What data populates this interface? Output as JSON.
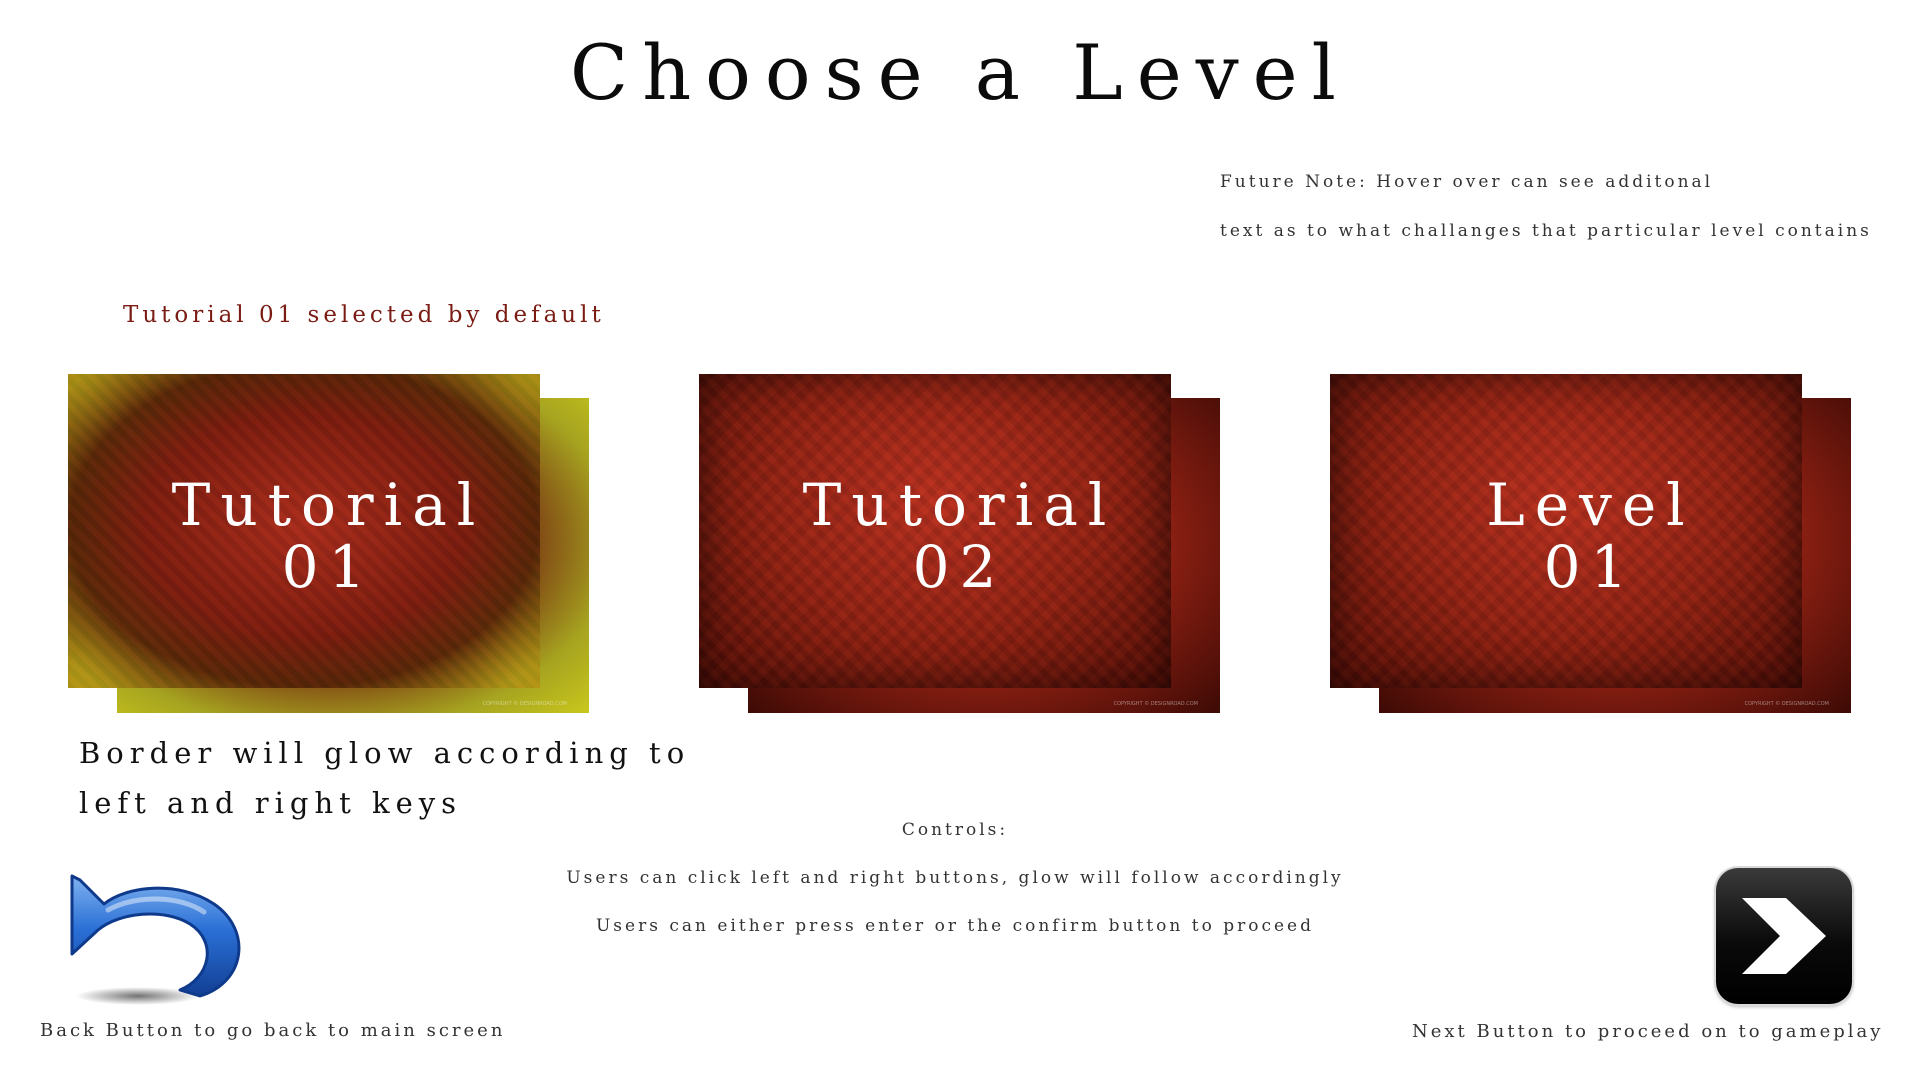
{
  "title": "Choose a Level",
  "future_note": {
    "line1": "Future Note: Hover over can see additonal",
    "line2": "text as to what challanges that particular level contains"
  },
  "default_note": "Tutorial 01 selected by default",
  "levels": [
    {
      "line1": "Tutorial",
      "line2": "01",
      "selected": true,
      "copyright": "COPYRIGHT © DESIGNROAD.COM"
    },
    {
      "line1": "Tutorial",
      "line2": "02",
      "selected": false,
      "copyright": "COPYRIGHT © DESIGNROAD.COM"
    },
    {
      "line1": "Level",
      "line2": "01",
      "selected": false,
      "copyright": "COPYRIGHT © DESIGNROAD.COM"
    }
  ],
  "glow_note": {
    "line1": "Border will glow according to",
    "line2": "left and right keys"
  },
  "controls": {
    "heading": "Controls:",
    "line1": "Users can click left and right buttons, glow will follow accordingly",
    "line2": "Users can either press enter or the confirm button to proceed"
  },
  "back_button": {
    "icon": "undo-arrow-icon",
    "caption": "Back Button to go back to main screen",
    "color": "#2a6fd6"
  },
  "next_button": {
    "icon": "chevron-right-icon",
    "caption": "Next Button to proceed on to gameplay"
  },
  "colors": {
    "selected_glow": "#c9c71c",
    "card_red": "#8e2214",
    "note_red": "#7a1c14"
  }
}
